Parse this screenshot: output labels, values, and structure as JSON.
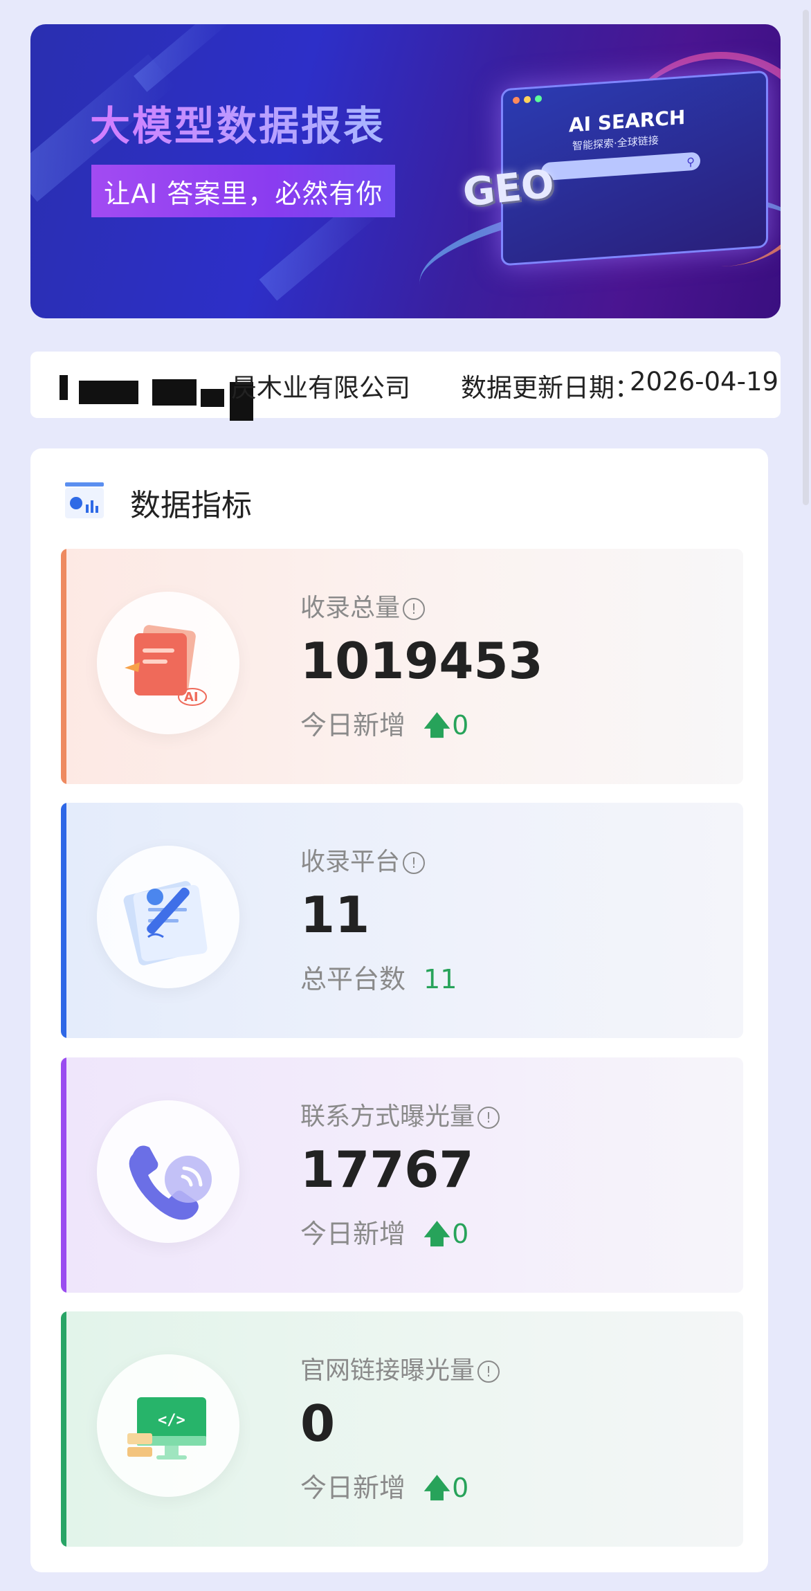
{
  "banner": {
    "title": "大模型数据报表",
    "tagline": "让AI 答案里，必然有你",
    "art_heading": "AI SEARCH",
    "art_subheading": "智能探索·全球链接",
    "art_logo": "GEO"
  },
  "company": {
    "name_visible": "昃木业有限公司",
    "update_label": "数据更新日期：",
    "update_date": "2026-04-19"
  },
  "metrics": {
    "section_title": "数据指标",
    "cards": [
      {
        "label": "收录总量",
        "value": "1019453",
        "sub_label": "今日新增",
        "sub_value": "0",
        "show_arrow": true,
        "icon": "document-ai-icon"
      },
      {
        "label": "收录平台",
        "value": "11",
        "sub_label": "总平台数",
        "sub_value": "11",
        "show_arrow": false,
        "icon": "signing-pen-icon"
      },
      {
        "label": "联系方式曝光量",
        "value": "17767",
        "sub_label": "今日新增",
        "sub_value": "0",
        "show_arrow": true,
        "icon": "phone-icon"
      },
      {
        "label": "官网链接曝光量",
        "value": "0",
        "sub_label": "今日新增",
        "sub_value": "0",
        "show_arrow": true,
        "icon": "monitor-code-icon"
      }
    ]
  },
  "colors": {
    "card_stripes": [
      "#ee8a60",
      "#2e67e6",
      "#9a4df0",
      "#28a466"
    ],
    "delta_green": "#27a35a",
    "page_bg": "#e7e9fb"
  }
}
